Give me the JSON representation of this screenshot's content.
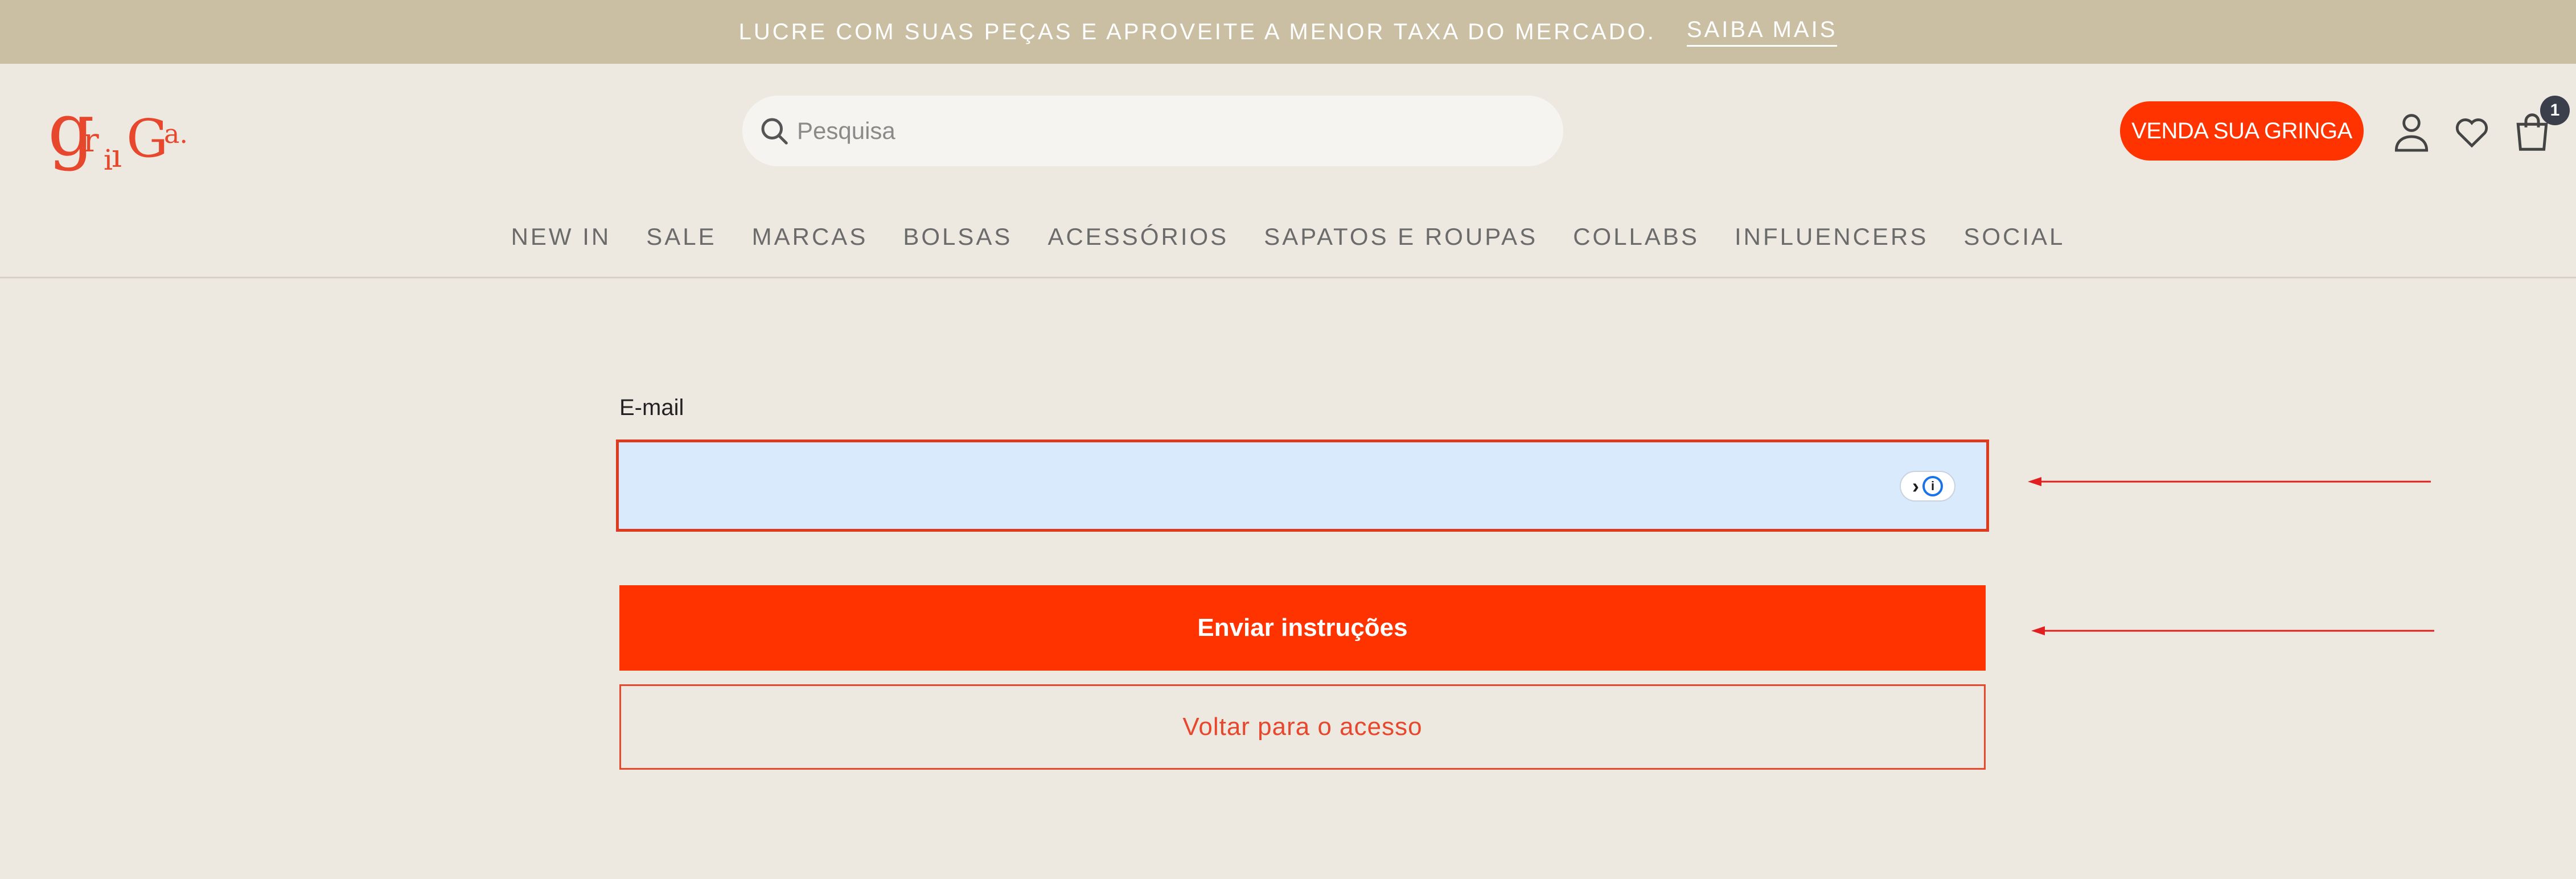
{
  "promo": {
    "text": "LUCRE COM SUAS PEÇAS E APROVEITE A MENOR TAXA DO MERCADO.",
    "link": "SAIBA MAIS"
  },
  "header": {
    "logo_text": "griiGa.",
    "search_placeholder": "Pesquisa",
    "sell_button": "VENDA SUA GRINGA",
    "cart_count": "1"
  },
  "nav": {
    "items": [
      "NEW IN",
      "SALE",
      "MARCAS",
      "BOLSAS",
      "ACESSÓRIOS",
      "SAPATOS E ROUPAS",
      "COLLABS",
      "INFLUENCERS",
      "SOCIAL"
    ]
  },
  "form": {
    "email_label": "E-mail",
    "email_value": "",
    "submit_label": "Enviar instruções",
    "back_label": "Voltar para o acesso"
  },
  "colors": {
    "accent": "#FF3300",
    "promo_bg": "#CBBFA3",
    "page_bg": "#EDE8E0",
    "input_bg": "#DAEAFD",
    "annotation_arrow": "#E02020"
  },
  "icons": [
    "search-icon",
    "user-icon",
    "heart-icon",
    "shopping-bag-icon",
    "password-manager-icon"
  ]
}
